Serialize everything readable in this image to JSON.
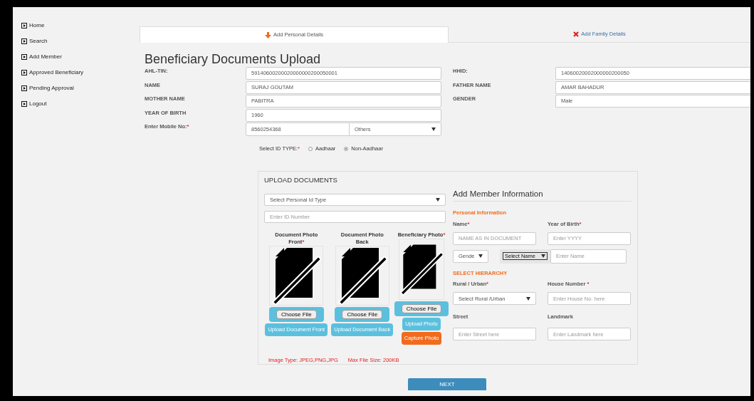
{
  "sidebar": {
    "items": [
      {
        "label": "Home"
      },
      {
        "label": "Search"
      },
      {
        "label": "Add Member"
      },
      {
        "label": "Approved Beneficiary"
      },
      {
        "label": "Pending Approval"
      },
      {
        "label": "Logout"
      }
    ]
  },
  "tabs": [
    {
      "label": "Add Personal Details",
      "selected": true,
      "kind": "arrow"
    },
    {
      "label": "Add Family Details",
      "selected": false,
      "kind": "cross"
    }
  ],
  "title": "Beneficiary Documents Upload",
  "details_left": [
    {
      "label": "AHL-TIN:",
      "value": "59140600200020000000200050001",
      "kind": "text"
    },
    {
      "label": "NAME",
      "value": "SURAJ GOUTAM",
      "kind": "text"
    },
    {
      "label": "MOTHER NAME",
      "value": "PABITRA",
      "kind": "text"
    },
    {
      "label": "YEAR OF BIRTH",
      "value": "1960",
      "kind": "text"
    },
    {
      "label": "Enter Mobile No:",
      "marker": "*",
      "value": "8560254368",
      "kind": "mobile",
      "option": "Others"
    }
  ],
  "details_right": [
    {
      "label": "HHID:",
      "value": "14060020002000000200050"
    },
    {
      "label": "FATHER NAME",
      "value": "AMAR BAHADUR"
    },
    {
      "label": "GENDER",
      "value": "Male"
    }
  ],
  "id_type": {
    "label": "Select ID TYPE:",
    "marker": "*",
    "options": [
      {
        "label": "Aadhaar",
        "selected": false
      },
      {
        "label": "Non-Aadhaar",
        "selected": true
      }
    ]
  },
  "upload": {
    "title": "UPLOAD DOCUMENTS",
    "id_type_select": "Select Personal Id Type",
    "id_number_placeholder": "Enter ID Number",
    "documents": [
      {
        "label": "Document Photo Front",
        "marker": "*",
        "buttons": [
          {
            "label": "Choose File",
            "kind": "file"
          },
          {
            "label": "Upload Document Front",
            "kind": "upload"
          }
        ]
      },
      {
        "label": "Document Photo Back",
        "buttons": [
          {
            "label": "Choose File",
            "kind": "file"
          },
          {
            "label": "Upload Document Back",
            "kind": "upload"
          }
        ]
      },
      {
        "label": "Beneficiary Photo",
        "marker": "*",
        "buttons": [
          {
            "label": "Choose File",
            "kind": "file"
          },
          {
            "label": "Upload Photo",
            "kind": "upload"
          },
          {
            "label": "Capture Photo",
            "kind": "capture"
          }
        ]
      }
    ],
    "notes": [
      "Image Type: JPEG,PNG,JPG",
      "Max File Size: 200KB"
    ]
  },
  "member": {
    "title": "Add Member Information",
    "personal_heading": "Personal Information",
    "name": {
      "label": "Name",
      "marker": "*",
      "placeholder": "NAME AS IN DOCUMENT"
    },
    "year": {
      "label": "Year of Birth",
      "marker": "*",
      "placeholder": "Enter YYYY"
    },
    "gender_select": "Gende",
    "name_type_select": "Select Name",
    "name_input_placeholder": "Enter Name",
    "hierarchy_heading": "SELECT HIERARCHY",
    "rural": {
      "label": "Rural / Urban",
      "marker": "*",
      "value": "Select Rural /Urban"
    },
    "house": {
      "label": "House Number ",
      "marker": "*",
      "placeholder": "Enter House No. here"
    },
    "street": {
      "label": "Street",
      "placeholder": "Enter Street here"
    },
    "landmark": {
      "label": "Landmark",
      "placeholder": "Enter Landmark here"
    }
  },
  "next_button": "NEXT"
}
